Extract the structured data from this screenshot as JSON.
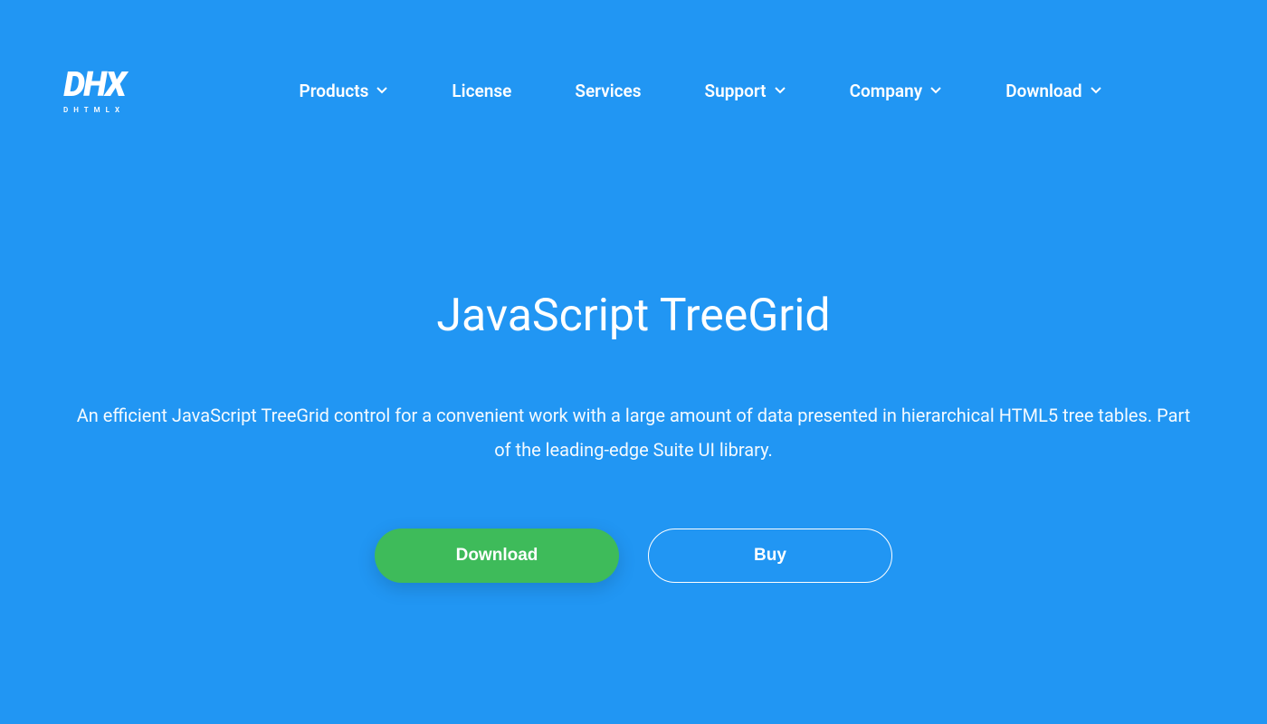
{
  "logo": {
    "main": "DHX",
    "sub": "DHTMLX"
  },
  "nav": {
    "items": [
      {
        "label": "Products",
        "has_dropdown": true
      },
      {
        "label": "License",
        "has_dropdown": false
      },
      {
        "label": "Services",
        "has_dropdown": false
      },
      {
        "label": "Support",
        "has_dropdown": true
      },
      {
        "label": "Company",
        "has_dropdown": true
      },
      {
        "label": "Download",
        "has_dropdown": true
      }
    ]
  },
  "hero": {
    "title": "JavaScript TreeGrid",
    "description": "An efficient JavaScript TreeGrid control for a convenient work with a large amount of data presented in hierarchical HTML5 tree tables. Part of the leading-edge Suite UI library.",
    "download_button": "Download",
    "buy_button": "Buy"
  }
}
